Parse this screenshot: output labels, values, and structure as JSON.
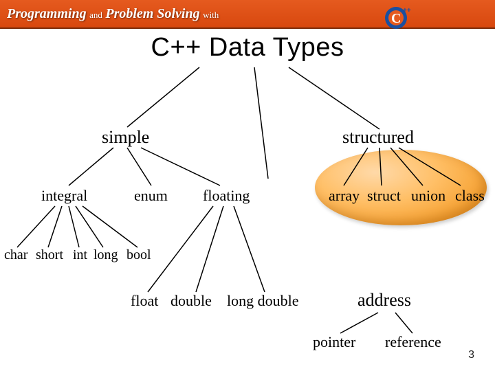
{
  "header": {
    "programming": "Programming",
    "and": "and",
    "problem_solving": "Problem Solving",
    "with": "with",
    "logo_alt": "C++"
  },
  "title": "C++  Data Types",
  "nodes": {
    "simple": "simple",
    "structured": "structured",
    "integral": "integral",
    "enum": "enum",
    "floating": "floating",
    "array": "array",
    "struct": "struct",
    "union": "union",
    "class": "class",
    "char": "char",
    "short": "short",
    "int": "int",
    "long": "long",
    "bool": "bool",
    "float": "float",
    "double": "double",
    "long_double": "long double",
    "address": "address",
    "pointer": "pointer",
    "reference": "reference"
  },
  "slide_number": "3"
}
